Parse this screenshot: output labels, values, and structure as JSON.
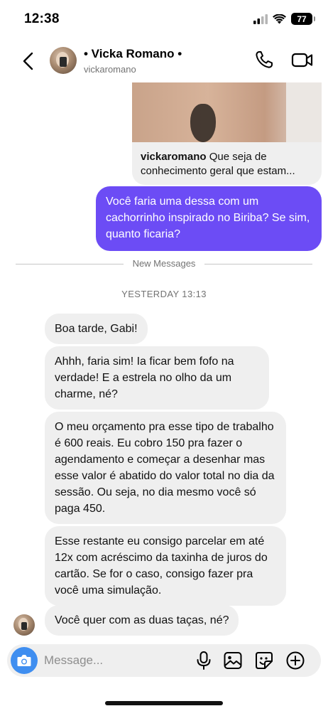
{
  "status_bar": {
    "time": "12:38",
    "battery": "77"
  },
  "header": {
    "name": "• Vicka Romano •",
    "username": "vickaromano"
  },
  "shared_post": {
    "author": "vickaromano",
    "caption_line1": " Que seja de",
    "caption_line2": "conhecimento geral que estam..."
  },
  "messages": {
    "outgoing_1": "Você faria uma dessa com um cachorrinho inspirado no Biriba? Se sim, quanto ficaria?",
    "divider_label": "New Messages",
    "timestamp": "YESTERDAY 13:13",
    "incoming": [
      "Boa tarde, Gabi!",
      "Ahhh, faria sim! Ia ficar bem fofo na verdade! E a estrela no olho da um charme, né?",
      "O meu orçamento pra esse tipo de trabalho é 600 reais. Eu cobro 150 pra fazer o agendamento e começar a desenhar mas esse valor é abatido do valor total no dia da sessão. Ou seja, no dia mesmo você só paga 450.",
      "Esse restante eu consigo parcelar em até 12x com acréscimo da taxinha de juros do cartão. Se for o caso, consigo fazer pra você uma simulação.",
      "Você quer com as duas taças, né?"
    ]
  },
  "composer": {
    "placeholder": "Message..."
  },
  "colors": {
    "outgoing_bubble": "#6c4cf5",
    "incoming_bubble": "#efefef",
    "camera_button": "#3f8ef0"
  },
  "icons": [
    "back-chevron-icon",
    "phone-icon",
    "video-camera-icon",
    "camera-icon",
    "microphone-icon",
    "gallery-icon",
    "sticker-icon",
    "plus-circle-icon",
    "signal-icon",
    "wifi-icon",
    "battery-icon"
  ]
}
